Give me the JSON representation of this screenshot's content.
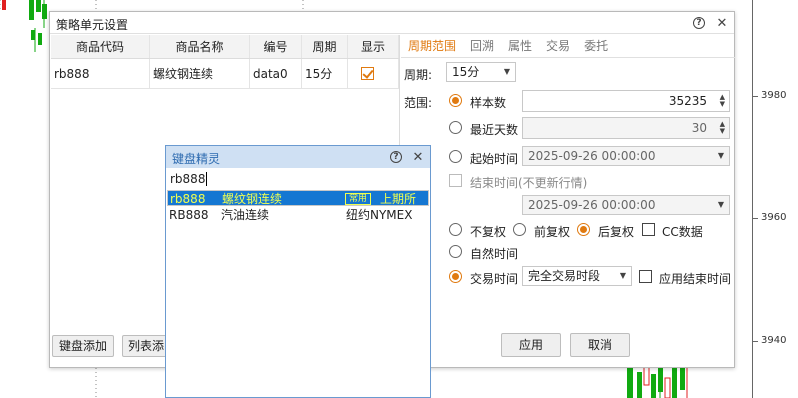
{
  "chart": {
    "price_labels": [
      "3980",
      "3960",
      "3940"
    ],
    "colors": {
      "up": "#e02020",
      "down": "#11aa11"
    }
  },
  "dialog": {
    "title": "策略单元设置",
    "help_icon": "help-icon",
    "close_icon": "close-icon",
    "table": {
      "headers": [
        "商品代码",
        "商品名称",
        "编号",
        "周期",
        "显示"
      ],
      "rows": [
        {
          "code": "rb888",
          "name": "螺纹钢连续",
          "id": "data0",
          "period": "15分",
          "show": true
        }
      ]
    },
    "buttons": {
      "keyboard_add": "键盘添加",
      "list_add": "列表添"
    },
    "tabs": [
      "周期范围",
      "回溯",
      "属性",
      "交易",
      "委托"
    ],
    "period_label": "周期:",
    "period_value": "15分",
    "range_label": "范围:",
    "sample_count_label": "样本数",
    "sample_count_value": "35235",
    "recent_days_label": "最近天数",
    "recent_days_value": "30",
    "start_time_label": "起始时间",
    "start_time_value": "2025-09-26 00:00:00",
    "end_time_label": "结束时间(不更新行情)",
    "end_time_value": "2025-09-26 00:00:00",
    "adjust_options": [
      "不复权",
      "前复权",
      "后复权"
    ],
    "cc_data_label": "CC数据",
    "natural_time_label": "自然时间",
    "trade_time_label": "交易时间",
    "trade_time_value": "完全交易时段",
    "apply_end_time_label": "应用结束时间",
    "apply_button": "应用",
    "cancel_button": "取消"
  },
  "keyboard_wizard": {
    "title": "键盘精灵",
    "input_value": "rb888",
    "results": [
      {
        "code": "rb888",
        "name": "螺纹钢连续",
        "tag": "常用",
        "exchange": "上期所",
        "selected": true
      },
      {
        "code": "RB888",
        "name": "汽油连续",
        "tag": "",
        "exchange": "纽约NYMEX",
        "selected": false
      }
    ]
  }
}
